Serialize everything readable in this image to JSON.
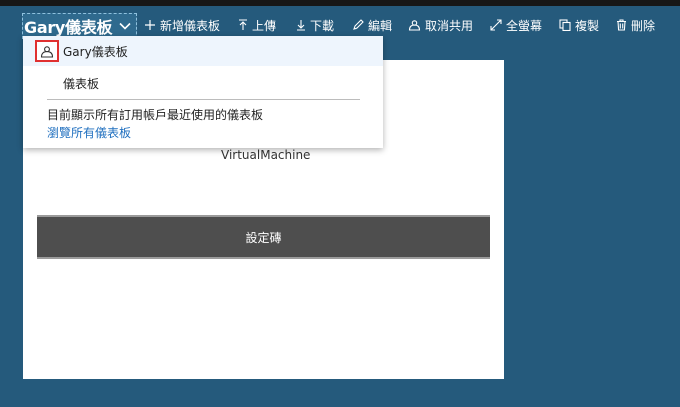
{
  "dashboard": {
    "title": "Gary儀表板"
  },
  "toolbar": {
    "new_label": "新增儀表板",
    "upload_label": "上傳",
    "download_label": "下載",
    "edit_label": "編輯",
    "unshare_label": "取消共用",
    "fullscreen_label": "全螢幕",
    "clone_label": "複製",
    "delete_label": "刪除"
  },
  "dropdown": {
    "items": [
      {
        "label": "Gary儀表板",
        "selected": true,
        "icon": "share-icon"
      },
      {
        "label": "儀表板",
        "selected": false
      }
    ],
    "note": "目前顯示所有訂用帳戶最近使用的儀表板",
    "browse_all": "瀏覽所有儀表板"
  },
  "tile": {
    "resource_name": "VirtualMachine",
    "setup_label": "設定磚"
  },
  "colors": {
    "background": "#255a7c",
    "accent_link": "#1f6fbf",
    "highlight_box": "#e03030",
    "setup_tile": "#4e4e4e"
  }
}
